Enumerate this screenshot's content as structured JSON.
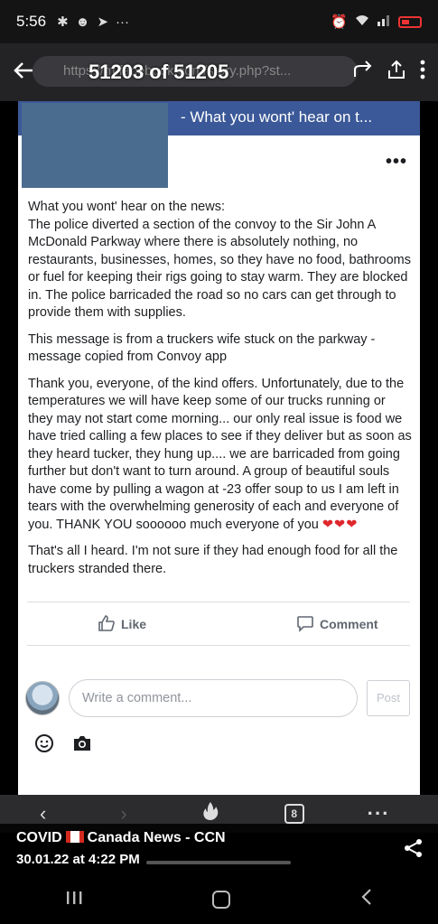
{
  "status_bar": {
    "time": "5:56",
    "left_icons": [
      "settings-icon",
      "snapchat-icon",
      "telegram-icon",
      "more-icon"
    ],
    "right_icons": [
      "alarm-icon",
      "wifi-icon",
      "signal-icon",
      "battery-icon"
    ]
  },
  "viewer": {
    "counter": "51203 of 51205",
    "url_text": "https://m.facebook.com/story.php?st..."
  },
  "post": {
    "header_title": "- What you wont' hear on t...",
    "more_label": "•••",
    "paragraphs": [
      "What you wont' hear on the news:\nThe police diverted a section of the convoy to the Sir John A McDonald Parkway where there is absolutely nothing, no restaurants, businesses, homes, so they have no food, bathrooms or fuel for keeping their rigs going to stay warm. They are blocked in. The police barricaded the road so no cars can get through to provide them with supplies.",
      "This message is from a truckers wife stuck on the parkway - message copied from Convoy app",
      "Thank you, everyone, of the kind offers. Unfortunately, due to the temperatures we will have keep some of our trucks running or they may not start come morning... our only real issue is food we have tried calling a few places to see if they deliver but as soon as they heard tucker, they hung up.... we are barricaded from going further but don't want to turn around. A group of beautiful souls have come by pulling a wagon at -23 offer soup to us I am left in tears with the overwhelming generosity of each and everyone of you. THANK YOU soooooo much everyone of you",
      "That's all I heard. I'm not sure if they had enough food for all the truckers stranded there."
    ],
    "hearts": "❤❤❤",
    "like_label": "Like",
    "comment_label": "Comment",
    "comment_placeholder": "Write a comment...",
    "post_button": "Post"
  },
  "viewer_nav": {
    "tabs_count": "8"
  },
  "caption": {
    "source_before_flag": "COVID",
    "source_after_flag": "Canada News - CCN",
    "date": "30.01.22 at 4:22 PM"
  },
  "colors": {
    "facebook_blue": "#3b5998",
    "heart_red": "#e0262d"
  }
}
